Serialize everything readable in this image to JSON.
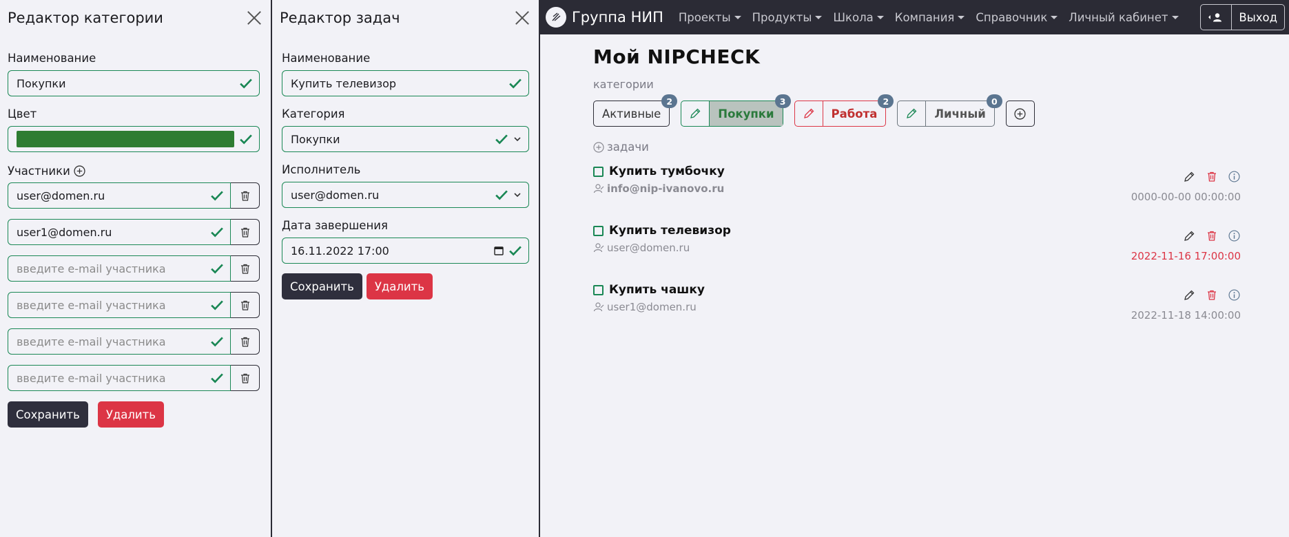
{
  "category_editor": {
    "title": "Редактор категории",
    "name_label": "Наименование",
    "name_value": "Покупки",
    "color_label": "Цвет",
    "color_value": "#2e7d32",
    "participants_label": "Участники",
    "participants": [
      {
        "value": "user@domen.ru",
        "placeholder": ""
      },
      {
        "value": "user1@domen.ru",
        "placeholder": ""
      },
      {
        "value": "",
        "placeholder": "введите e-mail участника"
      },
      {
        "value": "",
        "placeholder": "введите e-mail участника"
      },
      {
        "value": "",
        "placeholder": "введите e-mail участника"
      },
      {
        "value": "",
        "placeholder": "введите e-mail участника"
      }
    ],
    "save_label": "Сохранить",
    "delete_label": "Удалить"
  },
  "task_editor": {
    "title": "Редактор задач",
    "name_label": "Наименование",
    "name_value": "Купить телевизор",
    "category_label": "Категория",
    "category_value": "Покупки",
    "assignee_label": "Исполнитель",
    "assignee_value": "user@domen.ru",
    "due_label": "Дата завершения",
    "due_value": "16.11.2022 17:00",
    "save_label": "Сохранить",
    "delete_label": "Удалить"
  },
  "navbar": {
    "brand": "Группа НИП",
    "items": [
      "Проекты",
      "Продукты",
      "Школа",
      "Компания",
      "Справочник",
      "Личный кабинет"
    ],
    "logout_label": "Выход"
  },
  "main": {
    "title": "Мой NIPCHECK",
    "categories_label": "категории",
    "categories": [
      {
        "name": "Активные",
        "count": "2"
      },
      {
        "name": "Покупки",
        "count": "3"
      },
      {
        "name": "Работа",
        "count": "2"
      },
      {
        "name": "Личный",
        "count": "0"
      }
    ],
    "tasks_label": "задачи",
    "tasks": [
      {
        "title": "Купить тумбочку",
        "user": "info@nip-ivanovo.ru",
        "date": "0000-00-00 00:00:00"
      },
      {
        "title": "Купить телевизор",
        "user": "user@domen.ru",
        "date": "2022-11-16 17:00:00"
      },
      {
        "title": "Купить чашку",
        "user": "user1@domen.ru",
        "date": "2022-11-18 14:00:00"
      }
    ]
  },
  "colors": {
    "success": "#198754",
    "danger": "#dc3545",
    "dark": "#2b2b35",
    "badge": "#5b7590"
  }
}
